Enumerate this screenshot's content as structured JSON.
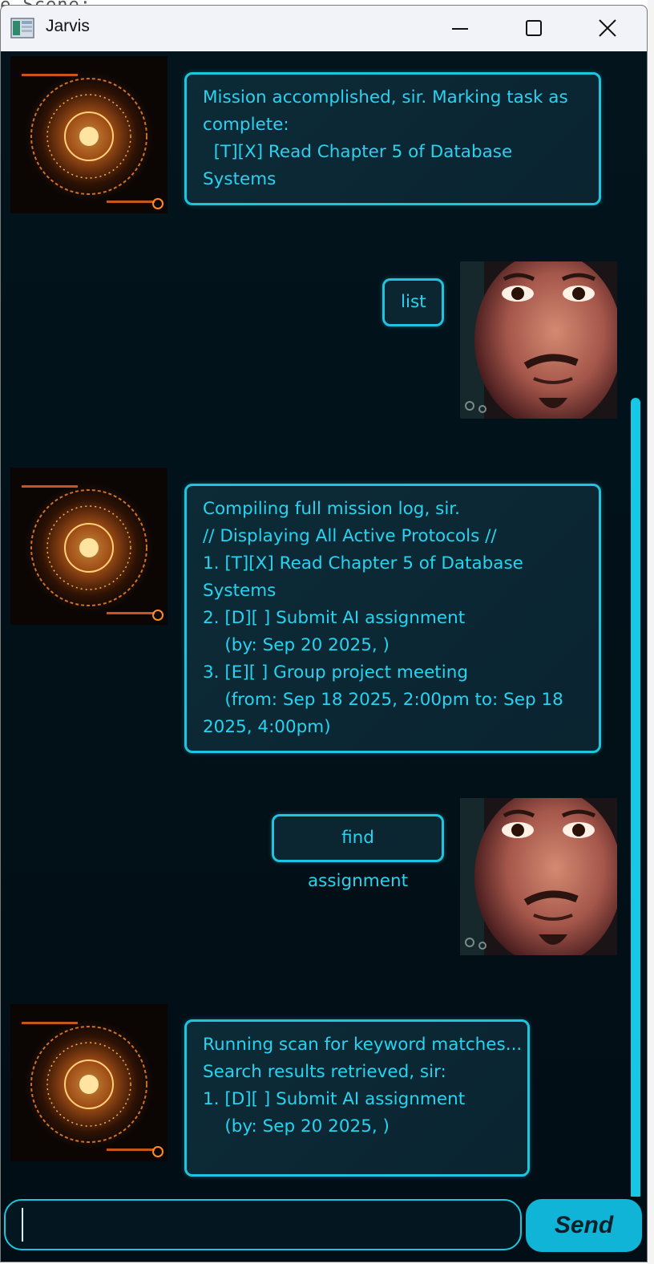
{
  "window": {
    "title": "Jarvis",
    "accent": "#1cc6e0",
    "text_color": "#27d3f0",
    "background": "#02121a"
  },
  "desktop": {
    "code_fragment": "e.Scene;"
  },
  "messages": [
    {
      "sender": "bot",
      "lines": [
        "Mission accomplished, sir. Marking task as",
        "complete:",
        "  [T][X] Read Chapter 5 of Database",
        "Systems"
      ]
    },
    {
      "sender": "user",
      "text": "list"
    },
    {
      "sender": "bot",
      "lines": [
        "Compiling full mission log, sir.",
        "// Displaying All Active Protocols //",
        "1. [T][X] Read Chapter 5 of Database",
        "Systems",
        "2. [D][ ] Submit AI assignment",
        "    (by: Sep 20 2025, )",
        "3. [E][ ] Group project meeting",
        "    (from: Sep 18 2025, 2:00pm to: Sep 18",
        "2025, 4:00pm)"
      ]
    },
    {
      "sender": "user",
      "text": "find assignment"
    },
    {
      "sender": "bot",
      "lines": [
        "Running scan for keyword matches...",
        "Search results retrieved, sir:",
        "1. [D][ ] Submit AI assignment",
        "    (by: Sep 20 2025, )"
      ]
    }
  ],
  "input": {
    "value": "",
    "placeholder": ""
  },
  "send_button": {
    "label": "Send"
  },
  "icons": {
    "bot_avatar": "arc-reactor-hologram-icon",
    "user_avatar": "tony-stark-portrait-icon"
  }
}
